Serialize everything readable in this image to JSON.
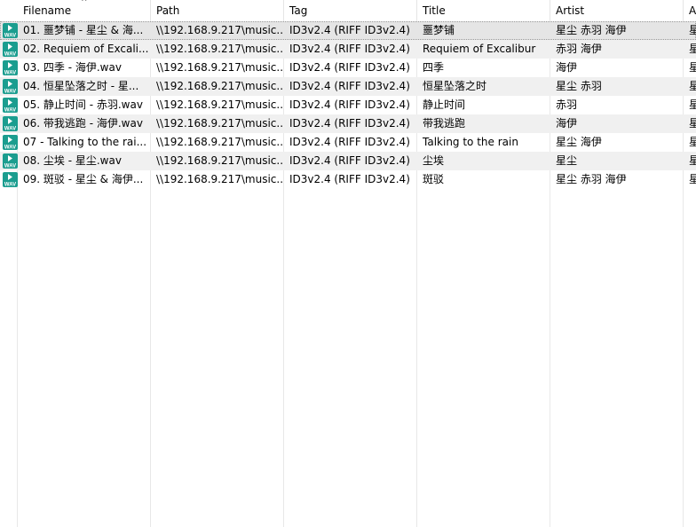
{
  "columns": [
    {
      "label": "Filename"
    },
    {
      "label": "Path"
    },
    {
      "label": "Tag"
    },
    {
      "label": "Title"
    },
    {
      "label": "Artist"
    },
    {
      "label": "A"
    }
  ],
  "sort_indicator": "^",
  "rows": [
    {
      "filename": "01. 噩梦铺 - 星尘 & 海...",
      "path": "\\\\192.168.9.217\\music...",
      "tag": "ID3v2.4 (RIFF ID3v2.4)",
      "title": "噩梦铺",
      "artist": "星尘 赤羽 海伊",
      "extra": "星",
      "icon": "wav-file-icon"
    },
    {
      "filename": "02. Requiem of Excali...",
      "path": "\\\\192.168.9.217\\music...",
      "tag": "ID3v2.4 (RIFF ID3v2.4)",
      "title": "Requiem of Excalibur",
      "artist": "赤羽 海伊",
      "extra": "星",
      "icon": "wav-file-icon"
    },
    {
      "filename": "03. 四季 - 海伊.wav",
      "path": "\\\\192.168.9.217\\music...",
      "tag": "ID3v2.4 (RIFF ID3v2.4)",
      "title": "四季",
      "artist": "海伊",
      "extra": "星",
      "icon": "wav-file-icon"
    },
    {
      "filename": "04. 恒星坠落之时 - 星...",
      "path": "\\\\192.168.9.217\\music...",
      "tag": "ID3v2.4 (RIFF ID3v2.4)",
      "title": "恒星坠落之时",
      "artist": "星尘 赤羽",
      "extra": "星",
      "icon": "wav-file-icon"
    },
    {
      "filename": "05. 静止时间 - 赤羽.wav",
      "path": "\\\\192.168.9.217\\music...",
      "tag": "ID3v2.4 (RIFF ID3v2.4)",
      "title": "静止时间",
      "artist": "赤羽",
      "extra": "星",
      "icon": "wav-file-icon"
    },
    {
      "filename": "06. 带我逃跑 - 海伊.wav",
      "path": "\\\\192.168.9.217\\music...",
      "tag": "ID3v2.4 (RIFF ID3v2.4)",
      "title": "带我逃跑",
      "artist": "海伊",
      "extra": "星",
      "icon": "wav-file-icon"
    },
    {
      "filename": "07 - Talking to the rai...",
      "path": "\\\\192.168.9.217\\music...",
      "tag": "ID3v2.4 (RIFF ID3v2.4)",
      "title": "Talking to the rain",
      "artist": "星尘 海伊",
      "extra": "星",
      "icon": "wav-file-icon"
    },
    {
      "filename": "08. 尘埃 - 星尘.wav",
      "path": "\\\\192.168.9.217\\music...",
      "tag": "ID3v2.4 (RIFF ID3v2.4)",
      "title": "尘埃",
      "artist": "星尘",
      "extra": "星",
      "icon": "wav-file-icon"
    },
    {
      "filename": "09. 斑驳 - 星尘 & 海伊...",
      "path": "\\\\192.168.9.217\\music...",
      "tag": "ID3v2.4 (RIFF ID3v2.4)",
      "title": "斑驳",
      "artist": "星尘 赤羽 海伊",
      "extra": "星",
      "icon": "wav-file-icon"
    }
  ]
}
